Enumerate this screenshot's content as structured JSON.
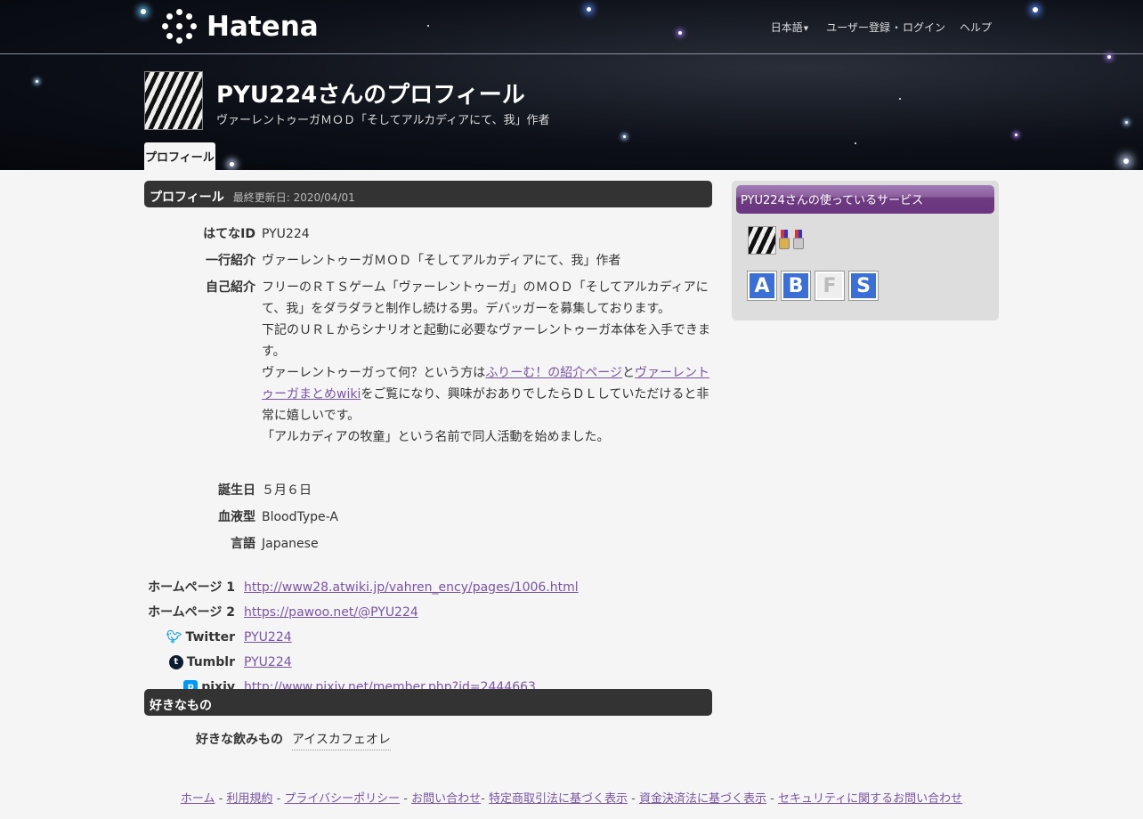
{
  "header": {
    "logo_text": "Hatena",
    "nav": {
      "language": "日本語",
      "register": "ユーザー登録",
      "separator": "・",
      "login": "ログイン",
      "help": "ヘルプ"
    },
    "title": "PYU224さんのプロフィール",
    "subtitle": "ヴァーレントゥーガＭＯＤ「そしてアルカディアにて、我」作者",
    "tab": "プロフィール"
  },
  "profile_section": {
    "heading": "プロフィール",
    "updated": "最終更新日: 2020/04/01",
    "rows": {
      "hatena_id": {
        "label": "はてなID",
        "value": "PYU224"
      },
      "one_line": {
        "label": "一行紹介",
        "value": "ヴァーレントゥーガＭＯＤ「そしてアルカディアにて、我」作者"
      },
      "intro": {
        "label": "自己紹介",
        "p1": "フリーのＲＴＳゲーム「ヴァーレントゥーガ」のＭＯＤ「そしてアルカディアにて、我」をダラダラと制作し続ける男。デバッガーを募集しております。",
        "p2": "下記のＵＲＬからシナリオと起動に必要なヴァーレントゥーガ本体を入手できます。",
        "p3_a": "ヴァーレントゥーガって何？という方は",
        "p3_link1": "ふりーむ！の紹介ページ",
        "p3_b": "と",
        "p3_link2": "ヴァーレントゥーガまとめwiki",
        "p3_c": "をご覧になり、興味がおありでしたらＤＬしていただけると非常に嬉しいです。",
        "p4": "「アルカディアの牧童」という名前で同人活動を始めました。"
      },
      "birthday": {
        "label": "誕生日",
        "value": "５月６日"
      },
      "blood": {
        "label": "血液型",
        "value": "BloodType-A"
      },
      "language": {
        "label": "言語",
        "value": "Japanese"
      }
    },
    "links": [
      {
        "label": "ホームページ 1",
        "value": "http://www28.atwiki.jp/vahren_ency/pages/1006.html"
      },
      {
        "label": "ホームページ 2",
        "value": "https://pawoo.net/@PYU224"
      },
      {
        "label": "Twitter",
        "value": "PYU224",
        "icon": "twitter-icon"
      },
      {
        "label": "Tumblr",
        "value": "PYU224",
        "icon": "tumblr-icon"
      },
      {
        "label": "pixiv",
        "value": "http://www.pixiv.net/member.php?id=2444663",
        "icon": "pixiv-icon"
      }
    ]
  },
  "likes_section": {
    "heading": "好きなもの",
    "drink_label": "好きな飲みもの",
    "drink_value": "アイスカフェオレ"
  },
  "sidebar": {
    "heading": "PYU224さんの使っているサービス",
    "services": [
      {
        "letter": "A",
        "icon": "hatena-antenna-icon",
        "color": "#3a6fd8"
      },
      {
        "letter": "B",
        "icon": "hatena-bookmark-icon",
        "color": "#3a6fd8"
      },
      {
        "letter": "F",
        "icon": "hatena-fotolife-icon",
        "color": "#c8c8c8"
      },
      {
        "letter": "S",
        "icon": "hatena-star-icon",
        "color": "#3a6fd8"
      }
    ]
  },
  "footer": {
    "links": [
      "ホーム",
      "利用規約",
      "プライバシーポリシー",
      "お問い合わせ",
      "特定商取引法に基づく表示",
      "資金決済法に基づく表示",
      "セキュリティに関するお問い合わせ"
    ],
    "separator": " - "
  }
}
